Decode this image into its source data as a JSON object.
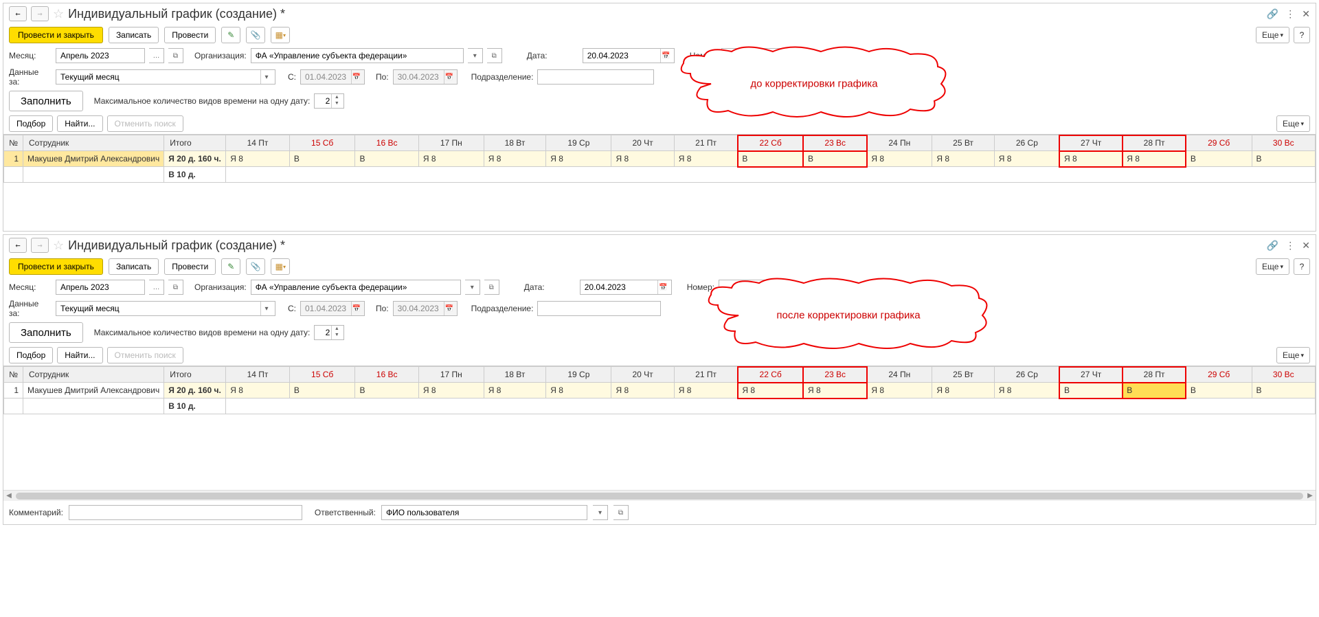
{
  "common": {
    "title": "Индивидуальный график (создание) *",
    "btn_post_close": "Провести и закрыть",
    "btn_save": "Записать",
    "btn_post": "Провести",
    "btn_more": "Еще",
    "lbl_month": "Месяц:",
    "val_month": "Апрель 2023",
    "lbl_org": "Организация:",
    "val_org": "ФА «Управление субъекта федерации»",
    "lbl_date": "Дата:",
    "val_date": "20.04.2023",
    "lbl_number": "Номер:",
    "val_number": "",
    "lbl_data_for": "Данные за:",
    "val_data_for": "Текущий месяц",
    "lbl_from": "С:",
    "val_from": "01.04.2023",
    "lbl_to": "По:",
    "val_to": "30.04.2023",
    "lbl_division": "Подразделение:",
    "val_division": "",
    "btn_fill": "Заполнить",
    "lbl_max_types": "Максимальное количество видов времени на одну дату:",
    "val_max_types": "2",
    "btn_pick": "Подбор",
    "btn_find": "Найти...",
    "btn_cancel_find": "Отменить поиск",
    "col_num": "№",
    "col_emp": "Сотрудник",
    "col_total": "Итого",
    "days": [
      {
        "label": "14 Пт",
        "weekend": false
      },
      {
        "label": "15 Сб",
        "weekend": true
      },
      {
        "label": "16 Вс",
        "weekend": true
      },
      {
        "label": "17 Пн",
        "weekend": false
      },
      {
        "label": "18 Вт",
        "weekend": false
      },
      {
        "label": "19 Ср",
        "weekend": false
      },
      {
        "label": "20 Чт",
        "weekend": false
      },
      {
        "label": "21 Пт",
        "weekend": false
      },
      {
        "label": "22 Сб",
        "weekend": true
      },
      {
        "label": "23 Вс",
        "weekend": true
      },
      {
        "label": "24 Пн",
        "weekend": false
      },
      {
        "label": "25 Вт",
        "weekend": false
      },
      {
        "label": "26 Ср",
        "weekend": false
      },
      {
        "label": "27 Чт",
        "weekend": false
      },
      {
        "label": "28 Пт",
        "weekend": false
      },
      {
        "label": "29 Сб",
        "weekend": true
      },
      {
        "label": "30 Вс",
        "weekend": true
      }
    ],
    "row_num": "1",
    "row_emp": "Макушев Дмитрий Александрович",
    "row_total1": "Я 20 д. 160 ч.",
    "row_total2": "В 10 д.",
    "v_ya8": "Я 8",
    "v_v": "В"
  },
  "top": {
    "cloud": "до корректировки графика",
    "cells": [
      "Я 8",
      "В",
      "В",
      "Я 8",
      "Я 8",
      "Я 8",
      "Я 8",
      "Я 8",
      "В",
      "В",
      "Я 8",
      "Я 8",
      "Я 8",
      "Я 8",
      "Я 8",
      "В",
      "В"
    ]
  },
  "bottom": {
    "cloud": "после корректировки графика",
    "cells": [
      "Я 8",
      "В",
      "В",
      "Я 8",
      "Я 8",
      "Я 8",
      "Я 8",
      "Я 8",
      "Я 8",
      "Я 8",
      "Я 8",
      "Я 8",
      "Я 8",
      "В",
      "В",
      "В",
      "В"
    ],
    "lbl_comment": "Комментарий:",
    "val_comment": "",
    "lbl_responsible": "Ответственный:",
    "val_responsible": "ФИО пользователя"
  }
}
